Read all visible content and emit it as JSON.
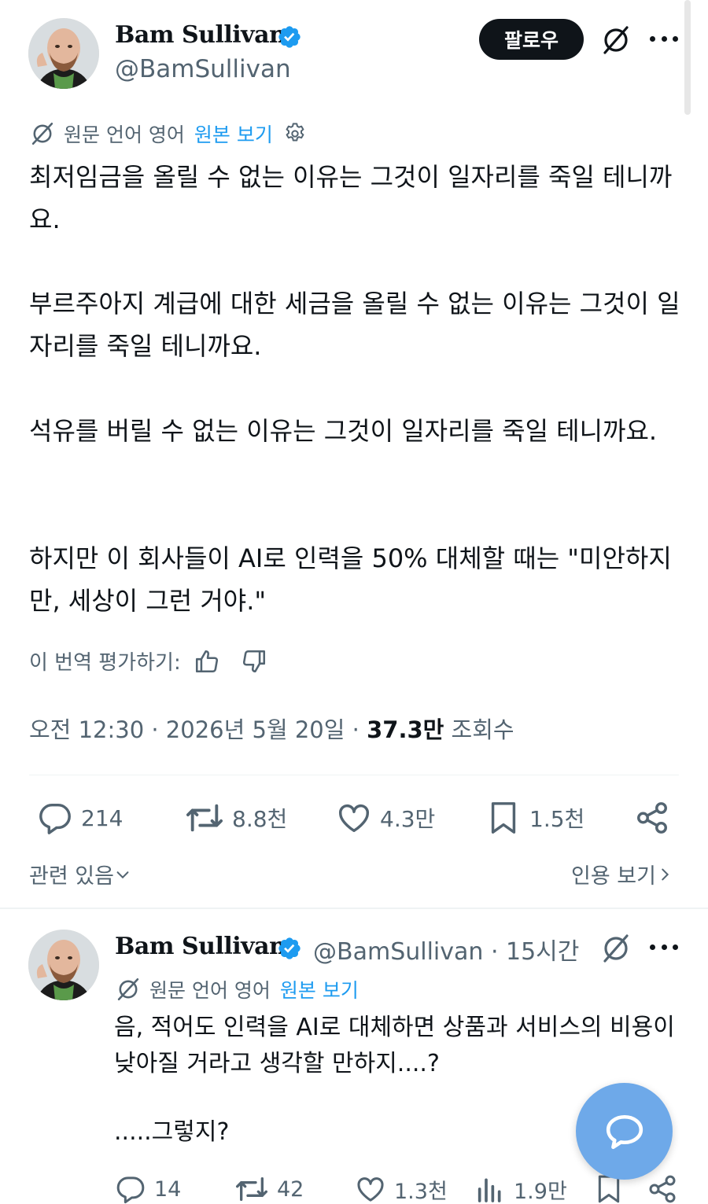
{
  "tweet": {
    "author_name": "Bam Sullivan",
    "author_handle": "@BamSullivan",
    "follow_label": "팔로우",
    "translation": {
      "prefix": "원문 언어 영어",
      "link": "원본 보기"
    },
    "paragraphs": [
      "최저임금을 올릴 수 없는 이유는 그것이 일자리를 죽일 테니까요.",
      "부르주아지 계급에 대한 세금을 올릴 수 없는 이유는 그것이 일자리를 죽일 테니까요.",
      "석유를 버릴 수 없는 이유는 그것이 일자리를 죽일 테니까요.",
      "하지만 이 회사들이 AI로 인력을 50% 대체할 때는 \"미안하지만, 세상이 그런 거야.\""
    ],
    "rate_label": "이 번역 평가하기:",
    "time": "오전 12:30 · 2026년 5월 20일 · ",
    "views_count": "37.3만",
    "views_label": " 조회수",
    "actions": {
      "replies": "214",
      "reposts": "8.8천",
      "likes": "4.3만",
      "bookmarks": "1.5천"
    },
    "related_label": "관련 있음",
    "quotes_label": "인용 보기"
  },
  "reply": {
    "author_name": "Bam Sullivan",
    "author_handle": "@BamSullivan · 15시간",
    "translation": {
      "prefix": "원문 언어 영어",
      "link": "원본 보기"
    },
    "text_line1": "음, 적어도 인력을 AI로 대체하면 상품과 서비스의 비용이 낮아질 거라고 생각할 만하지....?",
    "text_line2": ".....그렇지?",
    "actions": {
      "replies": "14",
      "reposts": "42",
      "likes": "1.3천",
      "views": "1.9만"
    }
  },
  "colors": {
    "text": "#0f1419",
    "secondary": "#536471",
    "link": "#1d9bf0",
    "verified": "#1d9bf0",
    "fab": "#6ea9e9"
  },
  "icons": [
    "verified-badge-icon",
    "grok-icon",
    "more-icon",
    "translate-icon",
    "gear-icon",
    "thumbs-up-icon",
    "thumbs-down-icon",
    "reply-icon",
    "repost-icon",
    "like-icon",
    "bookmark-icon",
    "share-icon",
    "views-icon",
    "chevron-down-icon",
    "chevron-right-icon",
    "chat-bubble-icon"
  ]
}
